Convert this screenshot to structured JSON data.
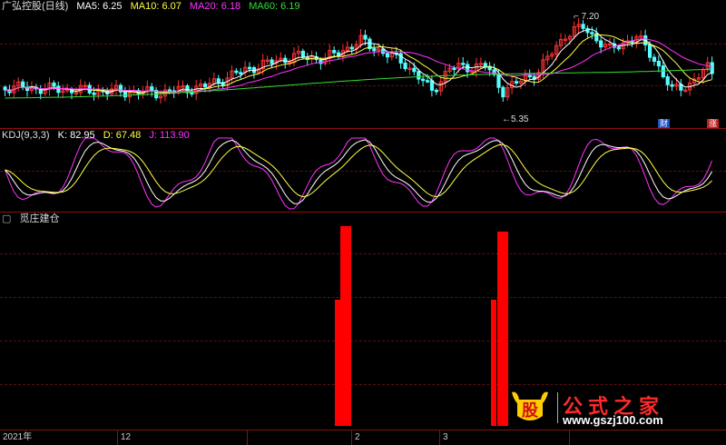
{
  "price_panel": {
    "title": "广弘控股(日线)",
    "ma": [
      {
        "label": "MA5: 6.25",
        "color": "#ffffff"
      },
      {
        "label": "MA10: 6.07",
        "color": "#ffff44"
      },
      {
        "label": "MA20: 6.18",
        "color": "#ff33ff"
      },
      {
        "label": "MA60: 6.19",
        "color": "#33dd33"
      }
    ],
    "high_label": "7.20",
    "low_label": "5.35",
    "badges": {
      "cai": "财",
      "zhang": "涨"
    }
  },
  "kdj_panel": {
    "title": "KDJ(9,3,3)",
    "k": "K: 82.95",
    "d": "D: 67.48",
    "j": "J: 113.90",
    "colors": {
      "k": "#ffffff",
      "d": "#ffff44",
      "j": "#ff33ff"
    }
  },
  "signal_panel": {
    "title": "觅庄建仓",
    "bar_color": "#ff0000"
  },
  "axis": {
    "ticks": [
      "2021年",
      "12",
      "",
      "2",
      "3",
      ""
    ]
  },
  "watermark": {
    "logo_char": "股",
    "brand": "公式之家",
    "url": "www.gszj100.com"
  },
  "colors": {
    "up": "#ff3333",
    "down": "#55ffff",
    "grid": "#8a1010"
  }
}
